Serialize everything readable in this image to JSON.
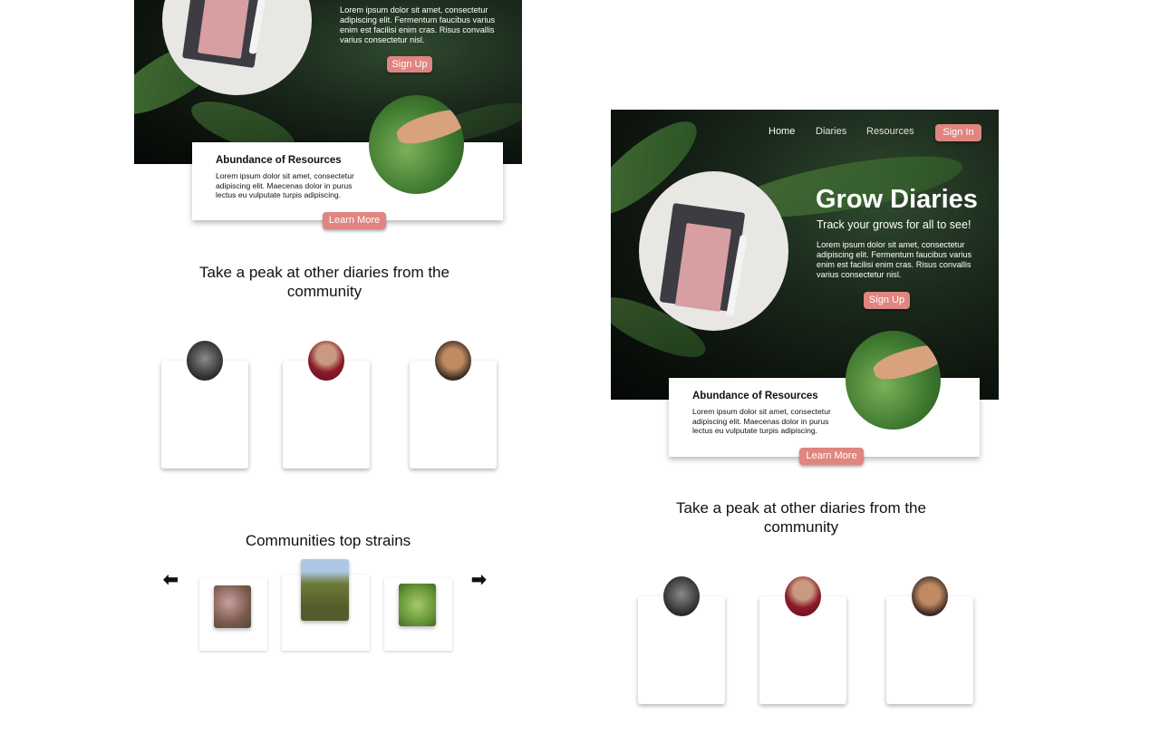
{
  "left": {
    "hero": {
      "body": "Lorem ipsum dolor sit amet, consectetur adipiscing elit. Fermentum faucibus varius enim est facilisi enim cras. Risus convallis varius consectetur nisl.",
      "signup_label": "Sign Up"
    },
    "resources_card": {
      "title": "Abundance of Resources",
      "body": "Lorem ipsum dolor sit amet, consectetur adipiscing elit. Maecenas dolor in purus lectus eu vulputate turpis adipiscing.",
      "button_label": "Learn More"
    },
    "community": {
      "title": "Take a peak at other diaries from the community"
    },
    "strains": {
      "title": "Communities top strains",
      "prev_icon": "arrow-left-icon",
      "next_icon": "arrow-right-icon"
    }
  },
  "right": {
    "nav": {
      "items": [
        "Home",
        "Diaries",
        "Resources"
      ],
      "signin_label": "Sign In"
    },
    "hero": {
      "title": "Grow Diaries",
      "subtitle": "Track your grows for all to see!",
      "body": "Lorem ipsum dolor sit amet, consectetur adipiscing elit. Fermentum faucibus varius enim est facilisi enim cras. Risus convallis varius consectetur nisl.",
      "signup_label": "Sign Up"
    },
    "resources_card": {
      "title": "Abundance of Resources",
      "body": "Lorem ipsum dolor sit amet, consectetur adipiscing elit. Maecenas dolor in purus lectus eu vulputate turpis adipiscing.",
      "button_label": "Learn More"
    },
    "community": {
      "title": "Take a peak at other diaries from the community"
    }
  },
  "colors": {
    "accent": "#e0857f",
    "hero_dark": "#0d130d",
    "card_bg": "#ffffff"
  }
}
